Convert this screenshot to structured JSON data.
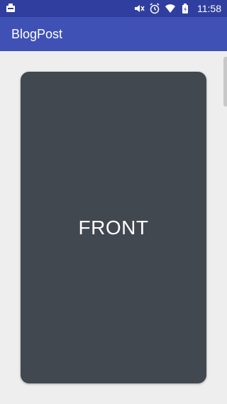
{
  "status_bar": {
    "time": "11:58",
    "icons": [
      "notification-icon",
      "mute-icon",
      "alarm-icon",
      "wifi-icon",
      "battery-icon"
    ]
  },
  "app_bar": {
    "title": "BlogPost"
  },
  "card": {
    "label": "FRONT"
  },
  "colors": {
    "status_bar": "#303f9f",
    "app_bar": "#3f51b5",
    "background": "#eeeeee",
    "card": "#424850"
  }
}
